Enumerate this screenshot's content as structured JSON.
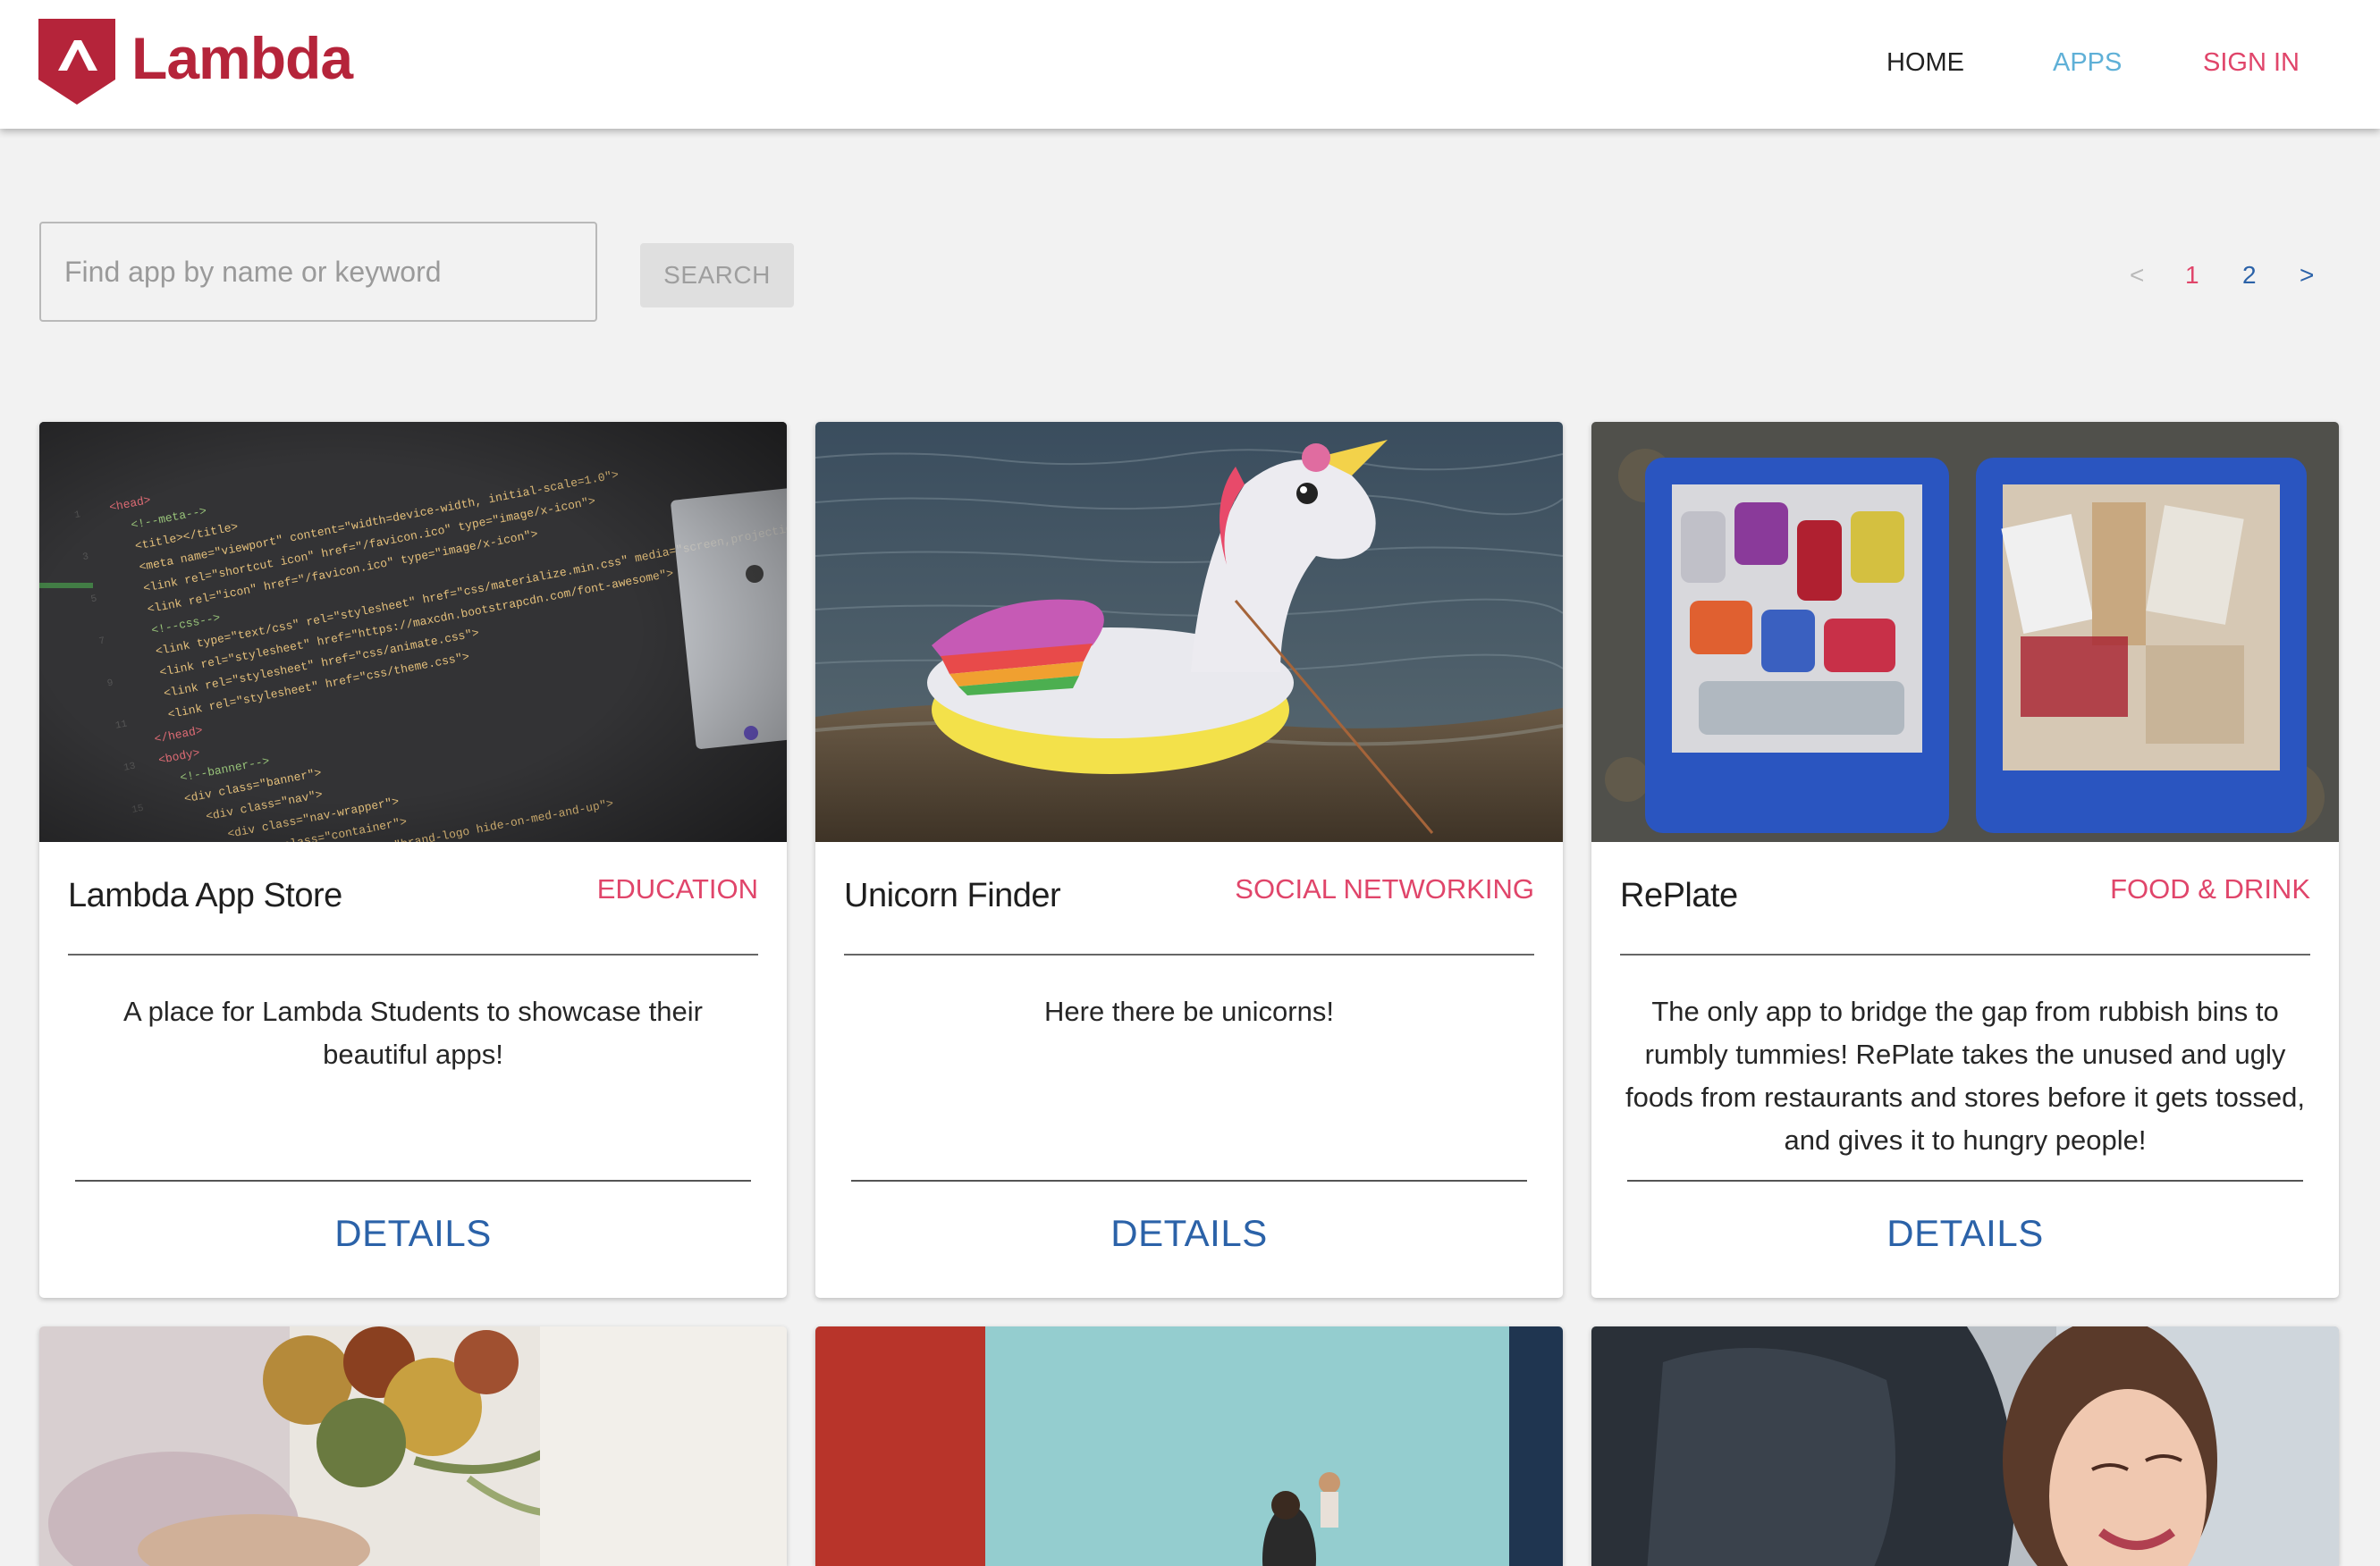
{
  "app": {
    "brand": "Lambda",
    "colors": {
      "brand": "#b5243a",
      "accent_blue": "#2b62a8",
      "nav_apps": "#5fb0d7",
      "nav_signin": "#e0456a",
      "category": "#e0456a"
    }
  },
  "nav": {
    "home": "HOME",
    "apps": "APPS",
    "signin": "SIGN IN"
  },
  "search": {
    "placeholder": "Find app by name or keyword",
    "value": "",
    "button": "SEARCH"
  },
  "pagination": {
    "prev": "<",
    "pages": [
      "1",
      "2"
    ],
    "next": ">",
    "current": "1"
  },
  "cards": [
    {
      "title": "Lambda App Store",
      "category": "EDUCATION",
      "description": "A place for Lambda Students to showcase their beautiful apps!",
      "details": "DETAILS",
      "image": "code-screen-photo"
    },
    {
      "title": "Unicorn Finder",
      "category": "SOCIAL NETWORKING",
      "description": "Here there be unicorns!",
      "details": "DETAILS",
      "image": "inflatable-unicorn-photo"
    },
    {
      "title": "RePlate",
      "category": "FOOD & DRINK",
      "description": "The only app to bridge the gap from rubbish bins to rumbly tummies! RePlate takes the unused and ugly foods from restaurants and stores before it gets tossed, and gives it to hungry people!",
      "details": "DETAILS",
      "image": "recycling-bins-photo"
    }
  ],
  "cards_partial": [
    {
      "image": "flower-bouquet-photo"
    },
    {
      "image": "mother-child-photo"
    },
    {
      "image": "smiling-woman-photo"
    }
  ]
}
